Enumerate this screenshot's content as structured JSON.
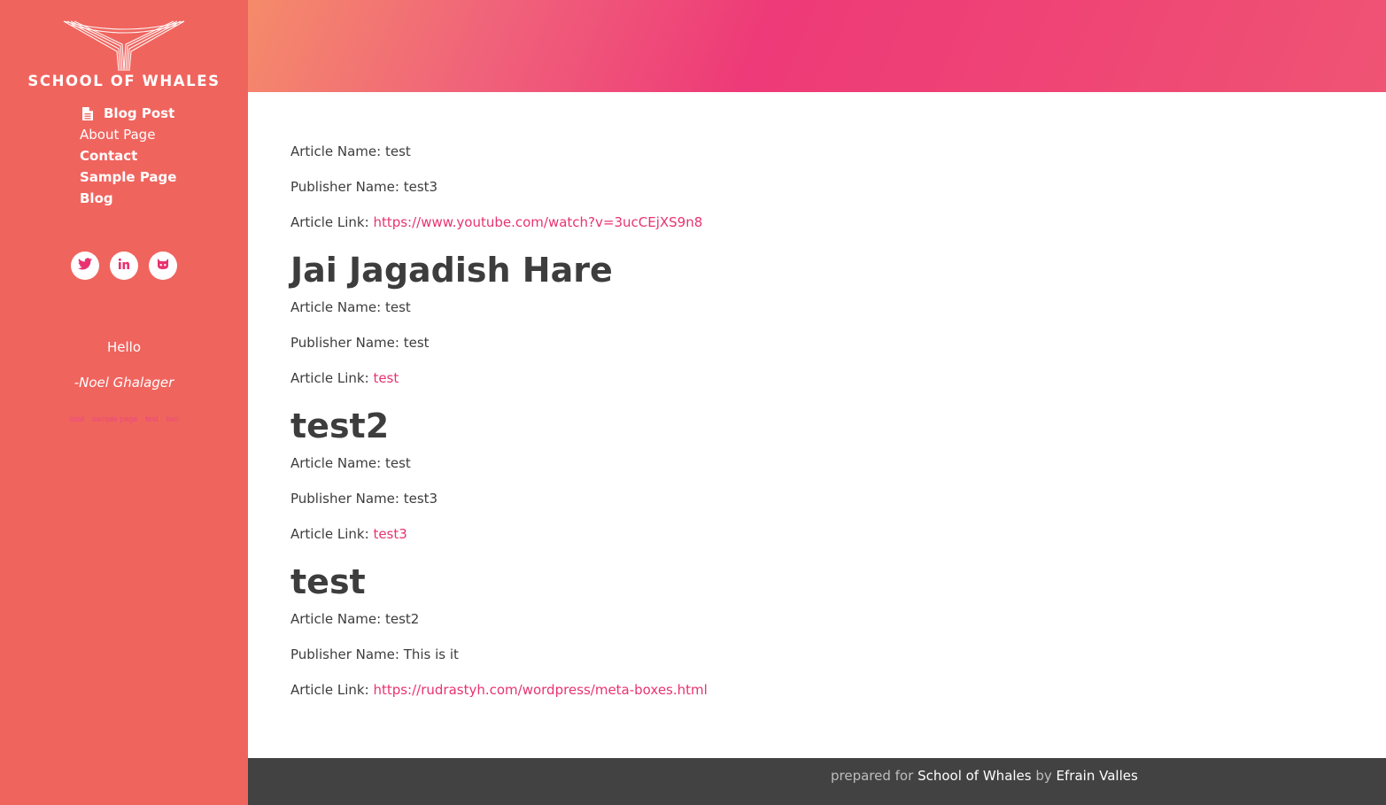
{
  "sidebar": {
    "logo_text": "SCHOOL OF WHALES",
    "nav": [
      {
        "label": "Blog Post",
        "icon": "document-icon"
      },
      {
        "label": "About Page"
      },
      {
        "label": "Contact"
      },
      {
        "label": "Sample Page"
      },
      {
        "label": "Blog"
      }
    ],
    "social": [
      {
        "name": "twitter-icon"
      },
      {
        "name": "linkedin-icon"
      },
      {
        "name": "github-icon"
      }
    ],
    "quote": "Hello",
    "quote_author": "-Noel Ghalager",
    "tags": [
      "cool",
      "sample page",
      "test",
      "two"
    ]
  },
  "main": {
    "first_entry": {
      "article_name_label": "Article Name: ",
      "article_name": "test",
      "publisher_name_label": "Publisher Name: ",
      "publisher_name": "test3",
      "article_link_label": "Article Link: ",
      "article_link": "https://www.youtube.com/watch?v=3ucCEjXS9n8"
    },
    "posts": [
      {
        "title": "Jai Jagadish Hare",
        "article_name": "test",
        "publisher_name": "test",
        "article_link": "test"
      },
      {
        "title": "test2",
        "article_name": "test",
        "publisher_name": "test3",
        "article_link": "test3"
      },
      {
        "title": "test",
        "article_name": "test2",
        "publisher_name": "This is it",
        "article_link": "https://rudrastyh.com/wordpress/meta-boxes.html"
      }
    ]
  },
  "footer": {
    "prefix": "prepared for ",
    "site": "School of Whales",
    "by": " by ",
    "author": "Efrain Valles"
  },
  "colors": {
    "sidebar": "#f0645e",
    "accent_link": "#e8336f",
    "footer": "#424242",
    "text": "#3d3d3d"
  }
}
